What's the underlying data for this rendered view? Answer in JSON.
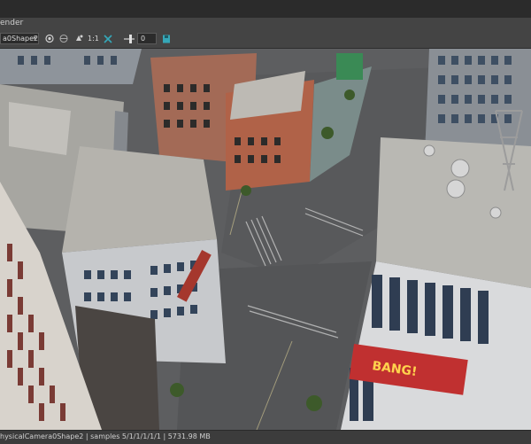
{
  "window": {
    "title": "ender"
  },
  "toolbar": {
    "camera_select": "a0Shape2",
    "ratio_label": "1:1",
    "exposure_value": "0"
  },
  "icons": {
    "render": "record-icon",
    "region": "region-icon",
    "channels": "channels-icon",
    "ratio": "ratio-text",
    "snapshot": "snapshot-icon",
    "slider": "exposure-slider",
    "save": "save-icon"
  },
  "status": {
    "text": "hysicalCamera0Shape2  |  samples 5/1/1/1/1/1  |  5731.98 MB"
  },
  "scene": {
    "billboard_text": "BANG!",
    "accent": "#35a7b8"
  }
}
